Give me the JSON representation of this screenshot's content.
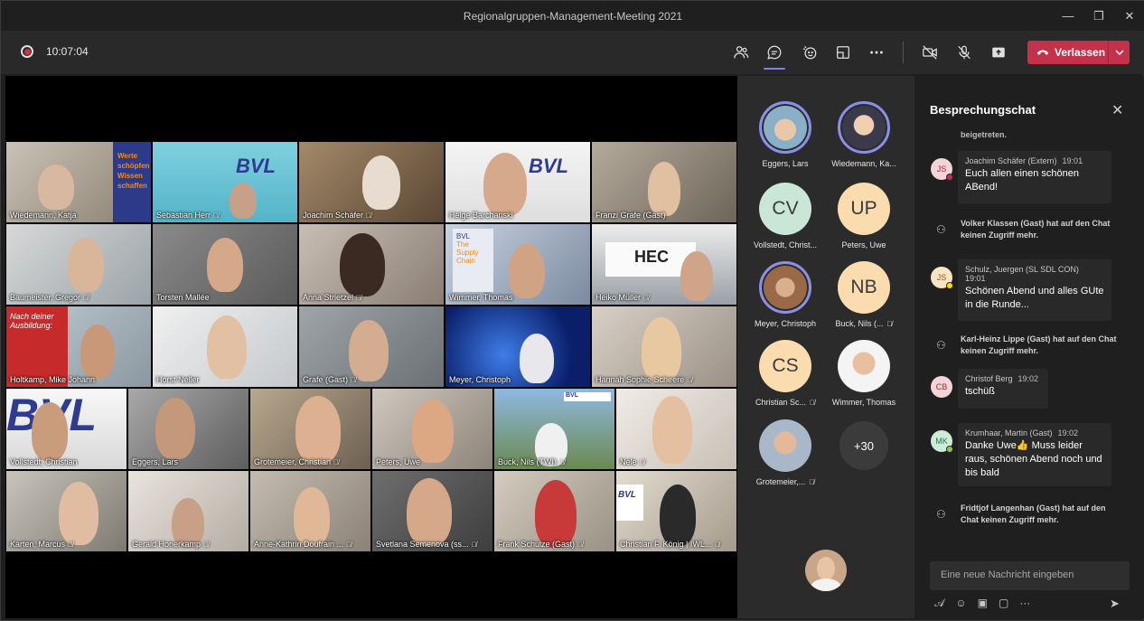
{
  "window": {
    "title": "Regionalgruppen-Management-Meeting 2021",
    "minimize": "—",
    "maximize": "❐",
    "close": "✕"
  },
  "toolbar": {
    "timer": "10:07:04",
    "leave_label": "Verlassen",
    "icons": [
      "people-icon",
      "chat-icon",
      "reactions-icon",
      "rooms-icon",
      "more-icon",
      "camera-off-icon",
      "mic-off-icon",
      "share-icon"
    ],
    "accent": "#7b83eb",
    "leave_color": "#c4314b"
  },
  "tiles": [
    {
      "name": "Wiedemann, Katja",
      "muted": false
    },
    {
      "name": "Sebastian Herr",
      "muted": true
    },
    {
      "name": "Joachim Schäfer",
      "muted": true
    },
    {
      "name": "Helge Barchanski",
      "muted": false
    },
    {
      "name": "Franzi Grafe (Gast)",
      "muted": false
    },
    {
      "name": "Baumeister, Gregor",
      "muted": true
    },
    {
      "name": "Torsten Mallée",
      "muted": false
    },
    {
      "name": "Anna Strietzel",
      "muted": true
    },
    {
      "name": "Wimmer, Thomas",
      "muted": false
    },
    {
      "name": "Heiko Müller",
      "muted": true
    },
    {
      "name": "Holtkamp, Mike Johann",
      "muted": false
    },
    {
      "name": "Horst Neller",
      "muted": false
    },
    {
      "name": "Grafe (Gast)",
      "muted": true
    },
    {
      "name": "Meyer, Christoph",
      "muted": false
    },
    {
      "name": "Hannah Sophie Scheere",
      "muted": true
    },
    {
      "name": "Vollstedt, Christian",
      "muted": false
    },
    {
      "name": "Eggers, Lars",
      "muted": false
    },
    {
      "name": "Grotemeier, Christian",
      "muted": true
    },
    {
      "name": "Peters, Uwe",
      "muted": false
    },
    {
      "name": "Buck, Nils (TWI)",
      "muted": true
    },
    {
      "name": "Nele",
      "muted": true
    },
    {
      "name": "Karten, Marcus",
      "muted": true
    },
    {
      "name": "Gerald Honerkamp",
      "muted": true
    },
    {
      "name": "Anne-Kathrin Doufrain ...",
      "muted": true
    },
    {
      "name": "Svetlana Semenova (ss...",
      "muted": true
    },
    {
      "name": "Frank Schulze (Gast)",
      "muted": true
    },
    {
      "name": "Christian F. König | IWL...",
      "muted": true
    }
  ],
  "tile_texts": {
    "werte": "Werte\nschöpfen\nWissen\nschaffen",
    "bvl": "BVL",
    "book": "Nach deiner\nAusbildung:",
    "hec": "HEC"
  },
  "roster": [
    {
      "label": "Eggers, Lars",
      "initials": "",
      "muted": false
    },
    {
      "label": "Wiedemann, Ka...",
      "initials": "",
      "muted": false
    },
    {
      "label": "Vollstedt, Christ...",
      "initials": "CV",
      "muted": false
    },
    {
      "label": "Peters, Uwe",
      "initials": "UP",
      "muted": false
    },
    {
      "label": "Meyer, Christoph",
      "initials": "",
      "muted": false
    },
    {
      "label": "Buck, Nils (...",
      "initials": "NB",
      "muted": true
    },
    {
      "label": "Christian Sc...",
      "initials": "CS",
      "muted": true
    },
    {
      "label": "Wimmer, Thomas",
      "initials": "",
      "muted": false
    },
    {
      "label": "Grotemeier,...",
      "initials": "",
      "muted": true
    }
  ],
  "roster_more": "+30",
  "chat": {
    "title": "Besprechungschat",
    "top_fragment": "beigetreten.",
    "messages": [
      {
        "initials": "JS",
        "author": "Joachim Schäfer (Extern)",
        "time": "19:01",
        "text": "Euch allen einen schönen ABend!"
      },
      {
        "initials": "JS",
        "author": "Schulz, Juergen (SL SDL CON)",
        "time": "19:01",
        "text": "Schönen Abend und alles GUte in die Runde..."
      },
      {
        "initials": "CB",
        "author": "Christof Berg",
        "time": "19:02",
        "text": "tschüß"
      },
      {
        "initials": "MK",
        "author": "Krumhaar, Martin (Gast)",
        "time": "19:02",
        "text": "Danke Uwe👍 Muss leider raus, schönen Abend noch und bis bald"
      }
    ],
    "system": [
      "Volker Klassen (Gast) hat auf den Chat keinen Zugriff mehr.",
      "Karl-Heinz Lippe (Gast) hat auf den Chat keinen Zugriff mehr.",
      "Fridtjof Langenhan (Gast) hat auf den Chat keinen Zugriff mehr."
    ],
    "compose_placeholder": "Eine neue Nachricht eingeben"
  }
}
